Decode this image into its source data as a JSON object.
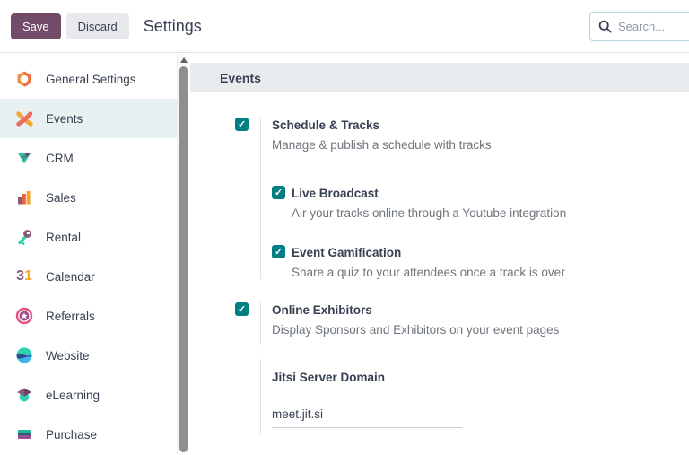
{
  "topbar": {
    "save_label": "Save",
    "discard_label": "Discard",
    "title": "Settings",
    "search_placeholder": "Search..."
  },
  "sidebar": {
    "items": [
      {
        "label": "General Settings",
        "icon": "general-settings-icon",
        "selected": false
      },
      {
        "label": "Events",
        "icon": "events-icon",
        "selected": true
      },
      {
        "label": "CRM",
        "icon": "crm-icon",
        "selected": false
      },
      {
        "label": "Sales",
        "icon": "sales-icon",
        "selected": false
      },
      {
        "label": "Rental",
        "icon": "rental-icon",
        "selected": false
      },
      {
        "label": "Calendar",
        "icon": "calendar-icon",
        "selected": false
      },
      {
        "label": "Referrals",
        "icon": "referrals-icon",
        "selected": false
      },
      {
        "label": "Website",
        "icon": "website-icon",
        "selected": false
      },
      {
        "label": "eLearning",
        "icon": "elearning-icon",
        "selected": false
      },
      {
        "label": "Purchase",
        "icon": "purchase-icon",
        "selected": false
      }
    ],
    "calendar_icon": {
      "digit1": "3",
      "digit2": "1"
    }
  },
  "main": {
    "section_title": "Events",
    "blocks": [
      {
        "label": "Schedule & Tracks",
        "description": "Manage & publish a schedule with tracks",
        "checked": true,
        "children": [
          {
            "label": "Live Broadcast",
            "description": "Air your tracks online through a Youtube integration",
            "checked": true
          },
          {
            "label": "Event Gamification",
            "description": "Share a quiz to your attendees once a track is over",
            "checked": true
          }
        ]
      },
      {
        "label": "Online Exhibitors",
        "description": "Display Sponsors and Exhibitors on your event pages",
        "checked": true
      }
    ],
    "fields": [
      {
        "label": "Jitsi Server Domain",
        "value": "meet.jit.si"
      }
    ]
  },
  "colors": {
    "primary": "#714B67",
    "checkbox": "#017E84",
    "selected_item_bg": "#E7F1F1",
    "section_header_bg": "#E9ECEF",
    "dark_text": "#374151",
    "muted_text": "#6E757C",
    "search_border": "#B5D6DE"
  }
}
